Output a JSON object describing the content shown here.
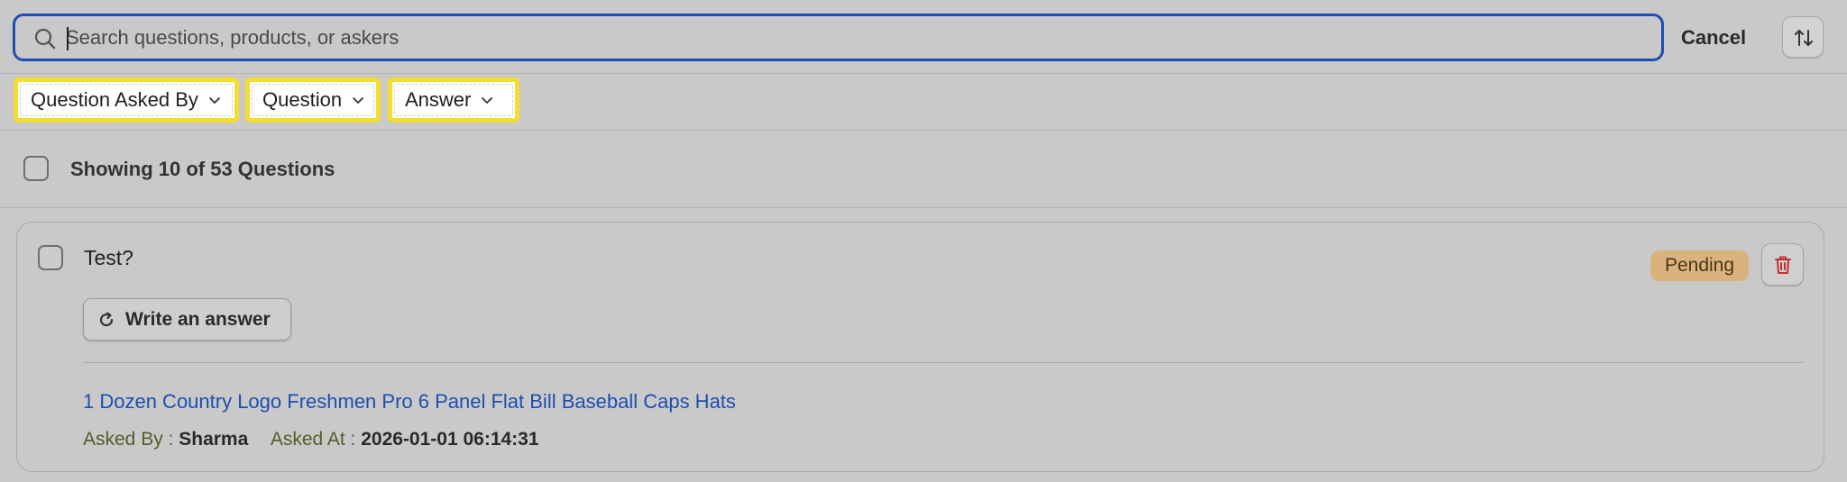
{
  "search": {
    "placeholder": "Search questions, products, or askers",
    "value": "",
    "cancel_label": "Cancel"
  },
  "filters": [
    {
      "label": "Question Asked By"
    },
    {
      "label": "Question"
    },
    {
      "label": "Answer"
    }
  ],
  "list": {
    "count_text": "Showing 10 of 53 Questions"
  },
  "question": {
    "text": "Test?",
    "status": "Pending",
    "answer_button_label": "Write an answer",
    "product": "1 Dozen Country Logo Freshmen Pro 6 Panel Flat Bill Baseball Caps Hats",
    "asked_by_label": "Asked By :",
    "asked_by": "Sharma",
    "asked_at_label": "Asked At :",
    "asked_at": "2026-01-01 06:14:31"
  },
  "colors": {
    "search_border": "#1e4fb0",
    "filter_highlight": "#f5dd2b",
    "status_badge": "#d9b27e",
    "link": "#1d4fae",
    "delete_icon": "#c62f2f"
  },
  "icons": {
    "search": "search-icon",
    "sort": "sort-icon",
    "chevron": "chevron-down-icon",
    "refresh": "refresh-icon",
    "delete": "trash-icon"
  }
}
